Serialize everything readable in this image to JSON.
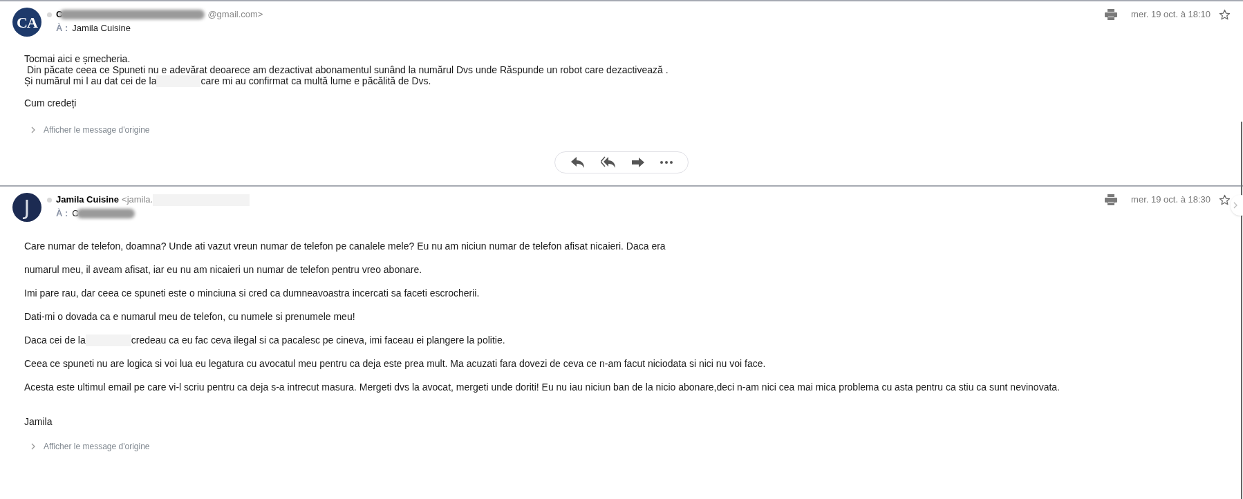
{
  "messages": [
    {
      "avatar": {
        "initials": "CA",
        "kind": "logo"
      },
      "sender": {
        "name": "C",
        "address": "@gmail.com>",
        "redacted": true
      },
      "to": {
        "label": "À :",
        "name": "Jamila Cuisine",
        "redacted": false
      },
      "date": "mer. 19 oct. à 18:10",
      "starred": false,
      "spaced": false,
      "paragraphs": [
        {
          "lines": [
            {
              "text": "Tocmai aici e șmecheria."
            },
            {
              "text": " Din păcate ceea ce Spuneti nu e adevărat deoarece am dezactivat abonamentul sunând la numărul Dvs unde Răspunde un robot care dezactivează ."
            },
            {
              "text": "Și numărul mi l au dat cei de la",
              "continuation": "care mi au confirmat ca multă lume e păcălită de Dvs."
            }
          ]
        },
        {
          "lines": [
            {
              "text": "Cum credeți"
            }
          ]
        }
      ],
      "show_original": "Afficher le message d'origine",
      "actions": true
    },
    {
      "avatar": {
        "initials": "J",
        "kind": "photo"
      },
      "sender": {
        "name": "Jamila Cuisine",
        "address": "<jamila.",
        "redacted": false
      },
      "to": {
        "label": "À :",
        "name": "C",
        "redacted": true
      },
      "date": "mer. 19 oct. à 18:30",
      "starred": false,
      "spaced": true,
      "paragraphs": [
        {
          "lines": [
            {
              "text": "Care numar de telefon, doamna? Unde ati vazut vreun numar de telefon pe canalele mele? Eu nu am niciun numar de telefon afisat nicaieri. Daca era"
            },
            {
              "text": "numarul meu, il aveam afisat, iar eu nu am nicaieri un numar de telefon pentru vreo abonare."
            },
            {
              "text": "Imi pare rau, dar ceea ce spuneti este o minciuna si cred ca dumneavoastra incercati sa faceti escrocherii."
            },
            {
              "text": "Dati-mi o dovada ca e numarul meu de telefon, cu numele si prenumele meu!"
            },
            {
              "text": "Daca cei de la",
              "continuation": "credeau ca eu fac ceva ilegal si ca pacalesc pe cineva, imi faceau ei plangere la politie."
            },
            {
              "text": "Ceea ce spuneti nu are logica si voi lua eu legatura cu avocatul meu pentru ca deja este prea mult. Ma acuzati fara dovezi de ceva ce n-am facut niciodata si nici nu voi face."
            },
            {
              "text": "Acesta este ultimul email pe care vi-l scriu pentru ca deja s-a intrecut masura. Mergeti dvs la avocat, mergeti unde doriti! Eu nu iau niciun ban de la nicio abonare,deci n-am nici cea mai mica problema cu asta pentru ca stiu ca sunt nevinovata."
            }
          ]
        },
        {
          "lines": [
            {
              "text": "Jamila"
            }
          ]
        }
      ],
      "show_original": "Afficher le message d'origine"
    }
  ]
}
